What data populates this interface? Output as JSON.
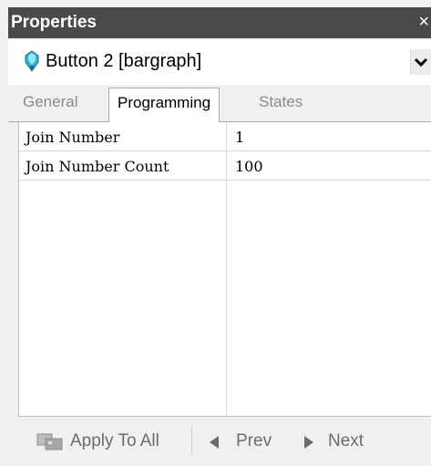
{
  "window": {
    "title": "Properties",
    "close_glyph": "×"
  },
  "selector": {
    "object_label": "Button 2  [bargraph]",
    "icon": "button-object-icon"
  },
  "tabs": [
    {
      "label": "General",
      "active": false
    },
    {
      "label": "Programming",
      "active": true
    },
    {
      "label": "States",
      "active": false
    }
  ],
  "grid": {
    "rows": [
      {
        "name": "Join Number",
        "value": "1"
      },
      {
        "name": "Join Number Count",
        "value": "100"
      }
    ]
  },
  "toolbar": {
    "apply_label": "Apply To All",
    "prev_label": "Prev",
    "next_label": "Next"
  }
}
